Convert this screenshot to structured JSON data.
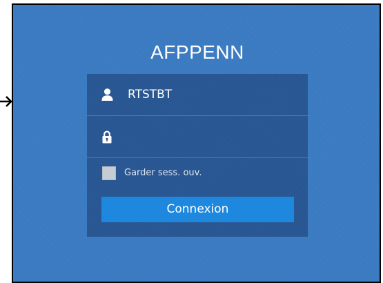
{
  "app": {
    "title": "AFPPENN"
  },
  "annotation": {
    "icon": "arrow-right-icon"
  },
  "login": {
    "username": {
      "value": "RTSTBT",
      "icon": "user-icon"
    },
    "password": {
      "value": "",
      "icon": "lock-icon"
    },
    "remember": {
      "label": "Garder sess. ouv.",
      "checked": false
    },
    "submit": {
      "label": "Connexion"
    }
  },
  "colors": {
    "background": "#3a7bc3",
    "button": "#1e88df",
    "text": "#ffffff",
    "checkbox": "#c6ccd3"
  }
}
